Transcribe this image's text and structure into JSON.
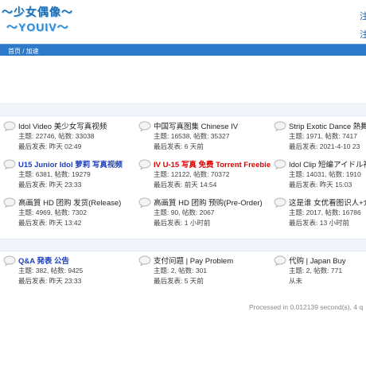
{
  "header": {
    "logo_line1": "～少女偶像～",
    "logo_line2": "～YOUIV～",
    "top_right_a": "注",
    "top_right_b": "注"
  },
  "breadcrumb": {
    "home": "首页",
    "sep": "/",
    "current": "加速"
  },
  "groups": [
    {
      "forums": [
        {
          "title": "Idol Video 美少女写真视频",
          "stats": "主题: 22746, 帖数: 33038",
          "last": "最后发表: 昨天 02:49",
          "style": "normal"
        },
        {
          "title": "中国写真图集 Chinese IV",
          "stats": "主题: 16538, 帖数: 35327",
          "last": "最后发表: 6 天前",
          "style": "normal"
        },
        {
          "title": "Strip Exotic Dance 熱舞",
          "stats": "主题: 1971, 帖数: 7417",
          "last": "最后发表: 2021-4-10 23",
          "style": "normal"
        },
        {
          "title": "U15 Junior Idol 萝莉 写真视频",
          "stats": "主题: 6381, 帖数: 19279",
          "last": "最后发表: 昨天 23:33",
          "style": "blue"
        },
        {
          "title": "IV U-15 写真 免费 Torrent Freebie",
          "stats": "主题: 12122, 帖数: 70372",
          "last": "最后发表: 前天 14:54",
          "style": "red"
        },
        {
          "title": "Idol Clip 短编アイドル視",
          "stats": "主题: 14031, 帖数: 1910",
          "last": "最后发表: 昨天 15:03",
          "style": "normal"
        },
        {
          "title": "高画質 HD 团购 发货(Release)",
          "stats": "主题: 4969, 帖数: 7302",
          "last": "最后发表: 昨天 13:42",
          "style": "normal"
        },
        {
          "title": "高画質 HD 团购 预购(Pre-Order)",
          "stats": "主题: 90, 帖数: 2067",
          "last": "最后发表: 1 小时前",
          "style": "normal"
        },
        {
          "title": "这是谁 女优看图识人+介",
          "stats": "主题: 2017, 帖数: 16786",
          "last": "最后发表: 13 小时前",
          "style": "normal"
        }
      ]
    },
    {
      "forums": [
        {
          "title": "Q&A 発表 公告",
          "stats": "主题: 382, 帖数: 9425",
          "last": "最后发表: 昨天 23:33",
          "style": "blue"
        },
        {
          "title": "支付问题 | Pay Problem",
          "stats": "主题: 2, 帖数: 301",
          "last": "最后发表: 5 天前",
          "style": "normal"
        },
        {
          "title": "代购 | Japan Buy",
          "stats": "主题: 2, 帖数: 771",
          "last": "从未",
          "style": "normal"
        }
      ]
    }
  ],
  "footer": {
    "processed": "Processed in 0.012139 second(s), 4 q"
  }
}
